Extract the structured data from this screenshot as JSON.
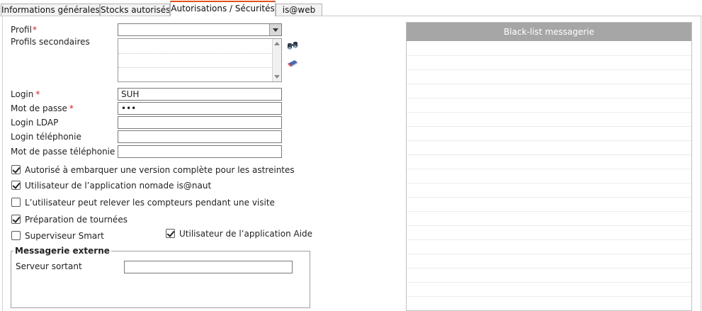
{
  "tabs": [
    {
      "label": "Informations générales",
      "active": false
    },
    {
      "label": "Stocks autorisés",
      "active": false
    },
    {
      "label": "Autorisations / Sécurités",
      "active": true
    },
    {
      "label": "is@web",
      "active": false
    }
  ],
  "form": {
    "required_marker": "*",
    "profil": {
      "label": "Profil",
      "value": ""
    },
    "profils_secondaires": {
      "label": "Profils secondaires",
      "items": [
        "",
        "",
        ""
      ]
    },
    "login": {
      "label": "Login",
      "value": "SUH"
    },
    "mot_de_passe": {
      "label": "Mot de passe",
      "value": "•••"
    },
    "login_ldap": {
      "label": "Login LDAP",
      "value": ""
    },
    "login_telephonie": {
      "label": "Login téléphonie",
      "value": ""
    },
    "mot_de_passe_telephonie": {
      "label": "Mot de passe téléphonie",
      "value": ""
    }
  },
  "checkboxes": [
    {
      "label": "Autorisé à embarquer une version complète pour les astreintes",
      "checked": true
    },
    {
      "label": "Utilisateur de l’application nomade is@naut",
      "checked": true
    },
    {
      "label": "L’utilisateur peut relever les compteurs pendant une visite",
      "checked": false
    },
    {
      "label": "Préparation de tournées",
      "checked": true
    },
    {
      "label": "Superviseur Smart",
      "checked": false
    },
    {
      "label": "Utilisateur de l’application Aide",
      "checked": true
    }
  ],
  "messagerie_externe": {
    "legend": "Messagerie externe",
    "serveur_sortant": {
      "label": "Serveur sortant",
      "value": ""
    }
  },
  "blacklist": {
    "title": "Black-list messagerie",
    "rows": []
  },
  "icons": {
    "search": "binoculars-icon",
    "clear": "eraser-icon"
  }
}
